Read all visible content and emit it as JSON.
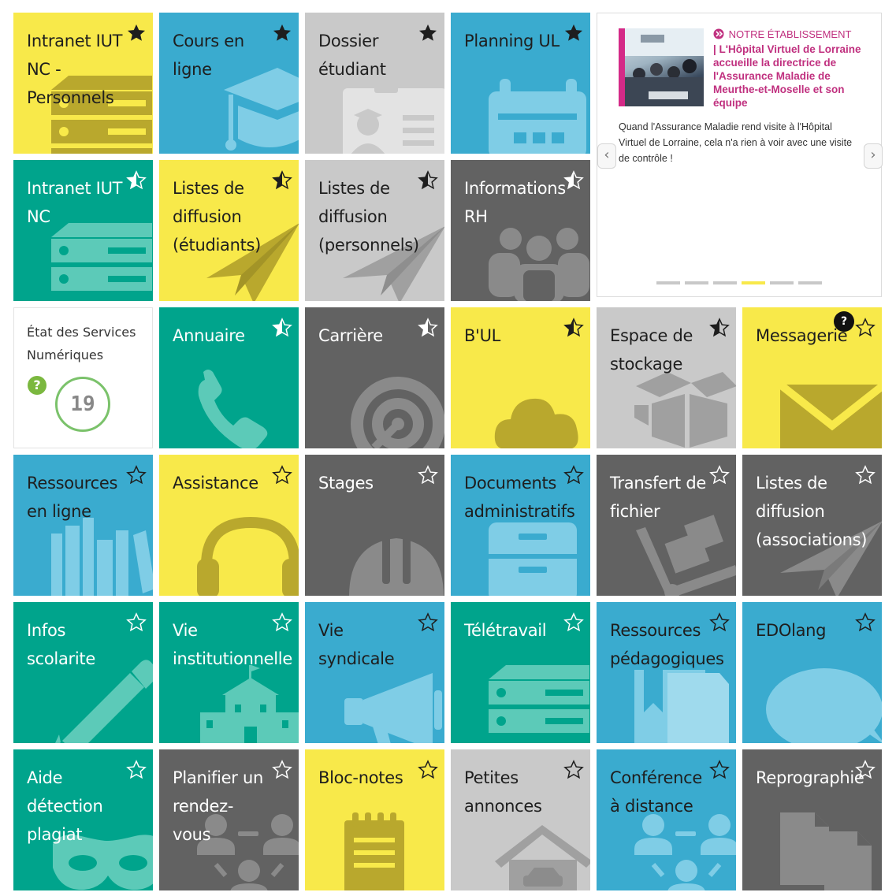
{
  "colors": {
    "yellow": "#f8e94a",
    "blue": "#3aabcf",
    "light_gray": "#c9c9c9",
    "dark_gray": "#626262",
    "green": "#00a48c",
    "accent_magenta": "#c0307f"
  },
  "tiles": {
    "intranet_iut_nc_personnels": {
      "label": "Intranet IUT NC - Personnels",
      "icon": "server-icon",
      "favorite": "filled"
    },
    "cours_en_ligne": {
      "label": "Cours en ligne",
      "icon": "graduation-cap-icon",
      "favorite": "filled"
    },
    "dossier_etudiant": {
      "label": "Dossier étudiant",
      "icon": "student-card-icon",
      "favorite": "filled"
    },
    "planning_ul": {
      "label": "Planning UL",
      "icon": "calendar-icon",
      "favorite": "filled"
    },
    "intranet_iut_nc": {
      "label": "Intranet IUT NC",
      "icon": "server-icon",
      "favorite": "half"
    },
    "listes_diffusion_etudiants": {
      "label": "Listes de diffusion (étudiants)",
      "icon": "paper-plane-icon",
      "favorite": "half"
    },
    "listes_diffusion_personnels": {
      "label": "Listes de diffusion (personnels)",
      "icon": "paper-plane-icon",
      "favorite": "half"
    },
    "informations_rh": {
      "label": "Informations RH",
      "icon": "people-icon",
      "favorite": "half"
    },
    "annuaire": {
      "label": "Annuaire",
      "icon": "phone-icon",
      "favorite": "half"
    },
    "carriere": {
      "label": "Carrière",
      "icon": "target-icon",
      "favorite": "half"
    },
    "bul": {
      "label": "B'UL",
      "icon": "cloud-icon",
      "favorite": "half"
    },
    "espace_stockage": {
      "label": "Espace de stockage",
      "icon": "box-icon",
      "favorite": "half"
    },
    "messagerie": {
      "label": "Messagerie",
      "icon": "envelope-icon",
      "favorite": "empty",
      "badge": "?"
    },
    "ressources_en_ligne": {
      "label": "Ressources en ligne",
      "icon": "books-icon",
      "favorite": "empty"
    },
    "assistance": {
      "label": "Assistance",
      "icon": "headphones-icon",
      "favorite": "empty"
    },
    "stages": {
      "label": "Stages",
      "icon": "helmet-icon",
      "favorite": "empty"
    },
    "documents_administratifs": {
      "label": "Documents administratifs",
      "icon": "file-cabinet-icon",
      "favorite": "empty"
    },
    "transfert_fichier": {
      "label": "Transfert de fichier",
      "icon": "hand-truck-icon",
      "favorite": "empty"
    },
    "listes_diffusion_associations": {
      "label": "Listes de diffusion (associations)",
      "icon": "paper-plane-icon",
      "favorite": "empty"
    },
    "infos_scolarite": {
      "label": "Infos scolarite",
      "icon": "pen-icon",
      "favorite": "empty"
    },
    "vie_institutionnelle": {
      "label": "Vie institutionnelle",
      "icon": "building-icon",
      "favorite": "empty"
    },
    "vie_syndicale": {
      "label": "Vie syndicale",
      "icon": "megaphone-icon",
      "favorite": "empty"
    },
    "teletravail": {
      "label": "Télétravail",
      "icon": "server-icon",
      "favorite": "empty"
    },
    "ressources_pedagogiques": {
      "label": "Ressources pédagogiques",
      "icon": "book-bookmark-icon",
      "favorite": "empty"
    },
    "edolang": {
      "label": "EDOlang",
      "icon": "speech-bubble-icon",
      "favorite": "empty"
    },
    "aide_detection_plagiat": {
      "label": "Aide détection plagiat",
      "icon": "mask-icon",
      "favorite": "empty"
    },
    "planifier_rendez_vous": {
      "label": "Planifier un rendez-vous",
      "icon": "meeting-icon",
      "favorite": "empty"
    },
    "bloc_notes": {
      "label": "Bloc-notes",
      "icon": "notepad-icon",
      "favorite": "empty"
    },
    "petites_annonces": {
      "label": "Petites annonces",
      "icon": "house-car-icon",
      "favorite": "empty"
    },
    "conference_distance": {
      "label": "Conférence à distance",
      "icon": "meeting-icon",
      "favorite": "empty"
    },
    "reprographie": {
      "label": "Reprographie",
      "icon": "copy-pages-icon",
      "favorite": "empty"
    }
  },
  "status_services": {
    "title": "État des Services Numériques",
    "help": "?",
    "count": "19"
  },
  "news": {
    "category": "NOTRE ÉTABLISSEMENT",
    "headline": "| L'Hôpital Virtuel de Lorraine accueille la directrice de l'Assurance Maladie de Meurthe-et-Moselle et son équipe",
    "summary": "Quand l'Assurance Maladie rend visite à l'Hôpital Virtuel de Lorraine, cela n'a rien à voir avec une visite de contrôle !",
    "prev": "‹",
    "next": "›",
    "slide_count": 6,
    "active_slide": 4
  }
}
